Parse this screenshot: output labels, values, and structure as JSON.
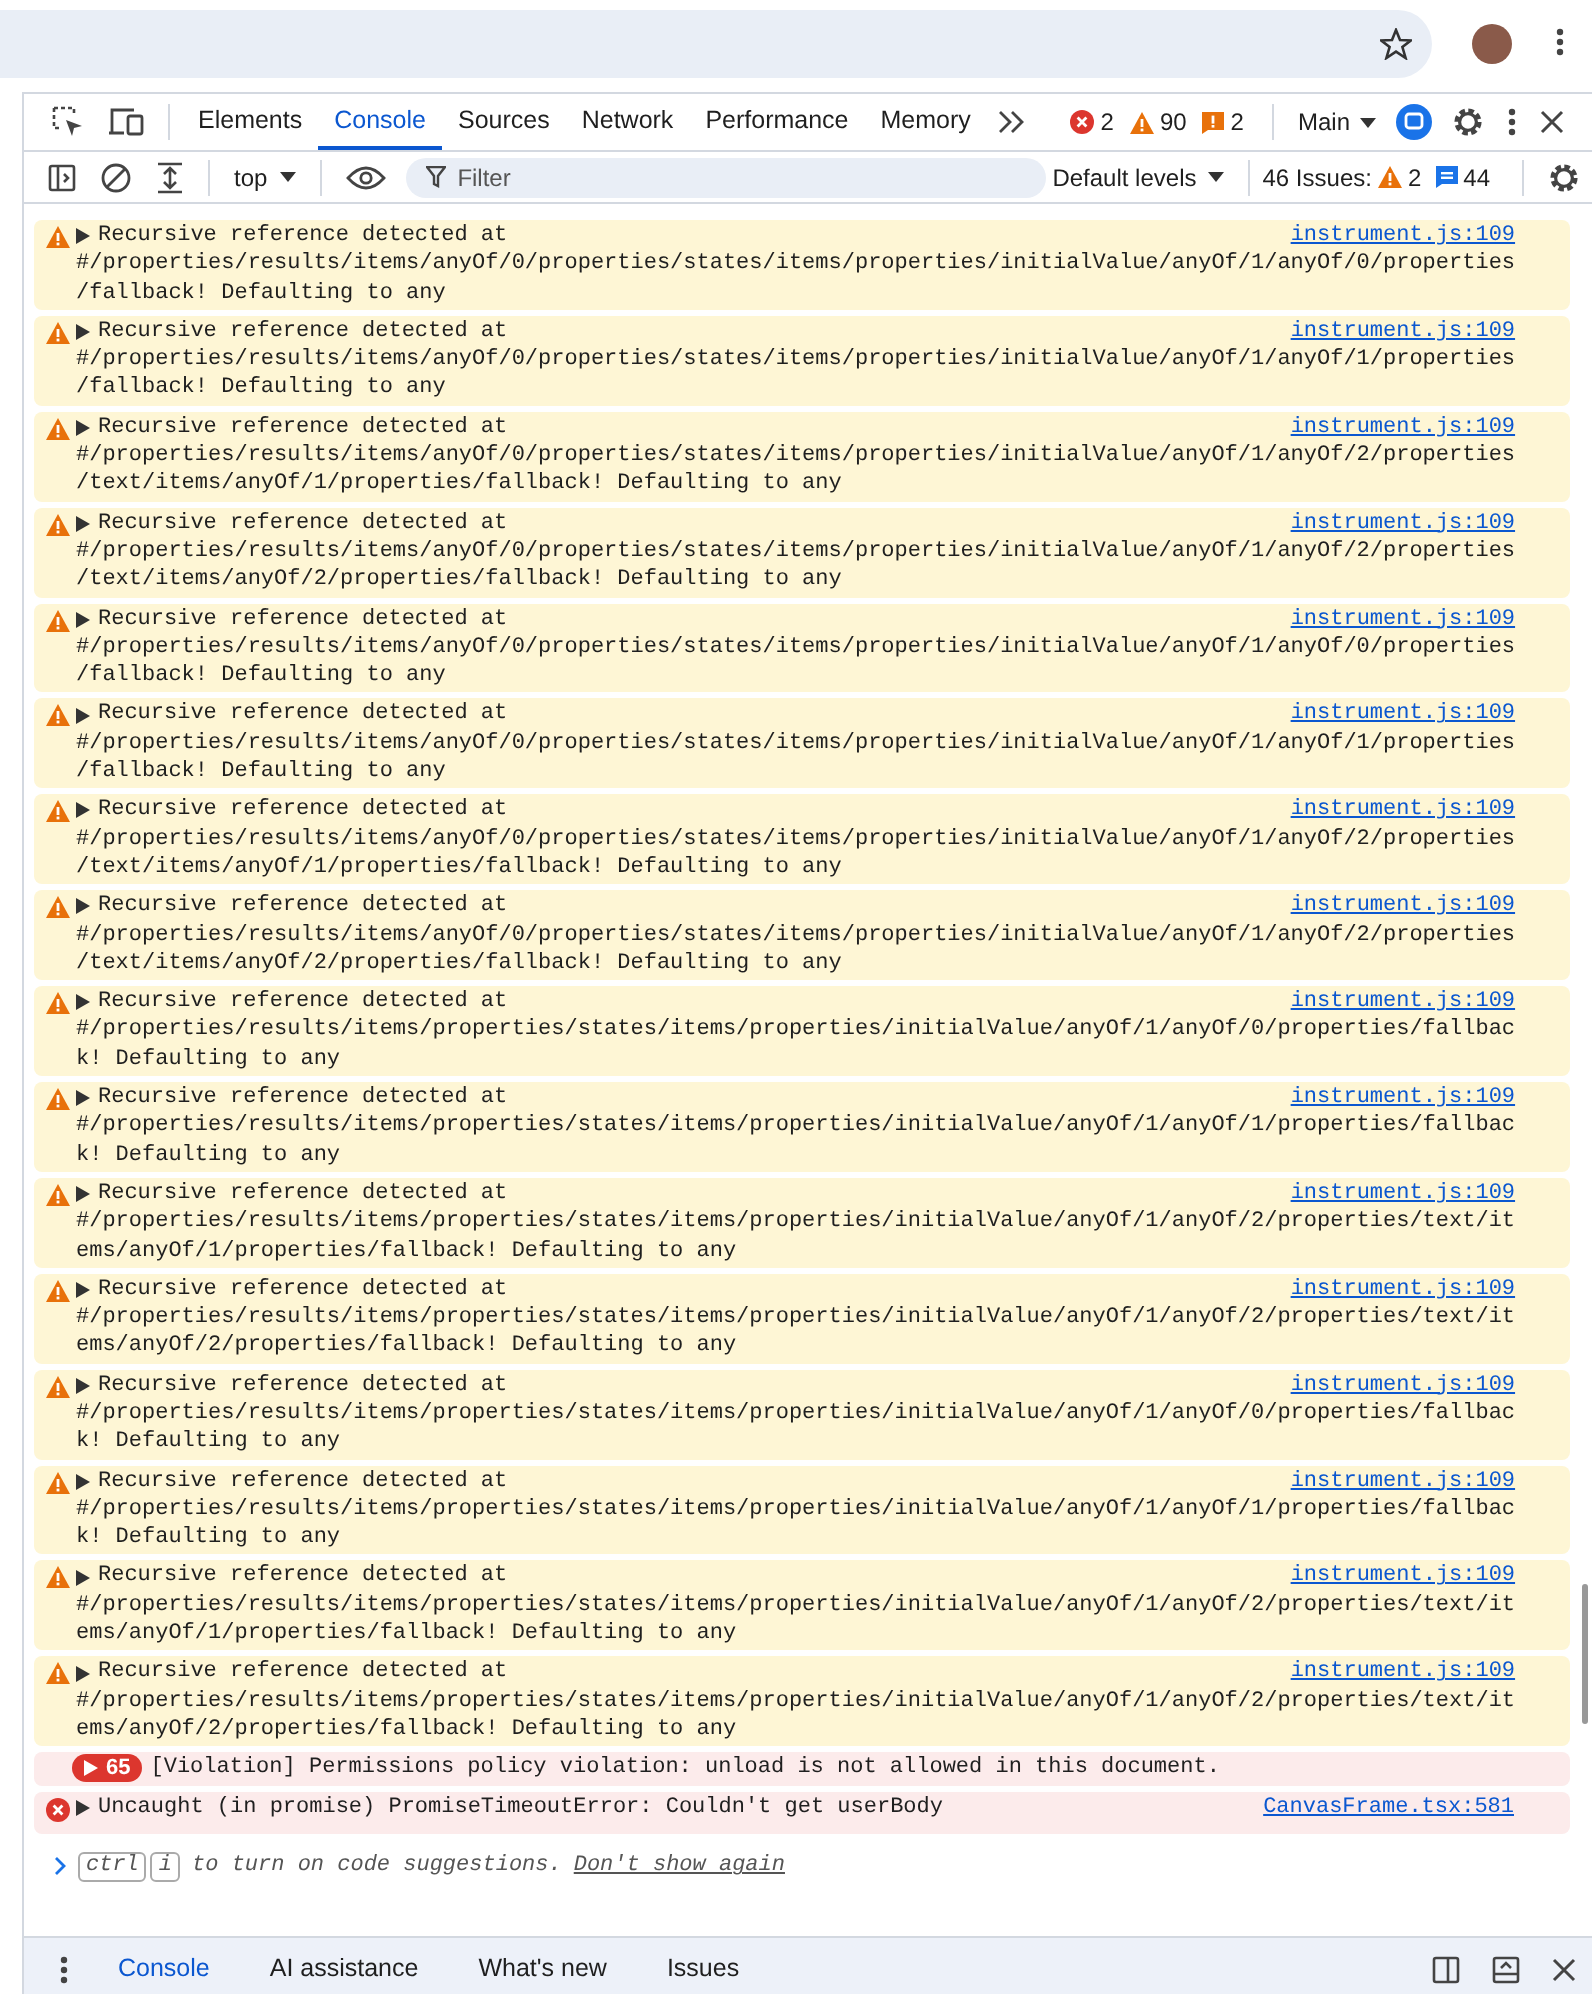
{
  "devtools": {
    "tabs": [
      {
        "label": "Elements",
        "selected": false
      },
      {
        "label": "Console",
        "selected": true
      },
      {
        "label": "Sources",
        "selected": false
      },
      {
        "label": "Network",
        "selected": false
      },
      {
        "label": "Performance",
        "selected": false
      },
      {
        "label": "Memory",
        "selected": false
      }
    ],
    "counts": [
      {
        "kind": "error",
        "count": "2"
      },
      {
        "kind": "warning",
        "count": "90"
      },
      {
        "kind": "issue",
        "count": "2"
      }
    ],
    "target": "Main"
  },
  "toolbar": {
    "context": "top",
    "filter_placeholder": "Filter",
    "levels": "Default levels",
    "issues_label": "46 Issues:",
    "issue_counts": [
      {
        "kind": "warning",
        "count": "2"
      },
      {
        "kind": "info",
        "count": "44"
      }
    ]
  },
  "messages": [
    {
      "kind": "warning",
      "lines": [
        "Recursive reference detected at",
        "#/properties/results/items/anyOf/0/properties/states/items/properties/initialValue/anyOf/1/anyOf/0/properties",
        "/fallback! Defaulting to any"
      ],
      "source": "instrument.js:109"
    },
    {
      "kind": "warning",
      "lines": [
        "Recursive reference detected at",
        "#/properties/results/items/anyOf/0/properties/states/items/properties/initialValue/anyOf/1/anyOf/1/properties",
        "/fallback! Defaulting to any"
      ],
      "source": "instrument.js:109"
    },
    {
      "kind": "warning",
      "lines": [
        "Recursive reference detected at",
        "#/properties/results/items/anyOf/0/properties/states/items/properties/initialValue/anyOf/1/anyOf/2/properties",
        "/text/items/anyOf/1/properties/fallback! Defaulting to any"
      ],
      "source": "instrument.js:109"
    },
    {
      "kind": "warning",
      "lines": [
        "Recursive reference detected at",
        "#/properties/results/items/anyOf/0/properties/states/items/properties/initialValue/anyOf/1/anyOf/2/properties",
        "/text/items/anyOf/2/properties/fallback! Defaulting to any"
      ],
      "source": "instrument.js:109"
    },
    {
      "kind": "warning",
      "lines": [
        "Recursive reference detected at",
        "#/properties/results/items/anyOf/0/properties/states/items/properties/initialValue/anyOf/1/anyOf/0/properties",
        "/fallback! Defaulting to any"
      ],
      "source": "instrument.js:109"
    },
    {
      "kind": "warning",
      "lines": [
        "Recursive reference detected at",
        "#/properties/results/items/anyOf/0/properties/states/items/properties/initialValue/anyOf/1/anyOf/1/properties",
        "/fallback! Defaulting to any"
      ],
      "source": "instrument.js:109"
    },
    {
      "kind": "warning",
      "lines": [
        "Recursive reference detected at",
        "#/properties/results/items/anyOf/0/properties/states/items/properties/initialValue/anyOf/1/anyOf/2/properties",
        "/text/items/anyOf/1/properties/fallback! Defaulting to any"
      ],
      "source": "instrument.js:109"
    },
    {
      "kind": "warning",
      "lines": [
        "Recursive reference detected at",
        "#/properties/results/items/anyOf/0/properties/states/items/properties/initialValue/anyOf/1/anyOf/2/properties",
        "/text/items/anyOf/2/properties/fallback! Defaulting to any"
      ],
      "source": "instrument.js:109"
    },
    {
      "kind": "warning",
      "lines": [
        "Recursive reference detected at",
        "#/properties/results/items/properties/states/items/properties/initialValue/anyOf/1/anyOf/0/properties/fallbac",
        "k! Defaulting to any"
      ],
      "source": "instrument.js:109"
    },
    {
      "kind": "warning",
      "lines": [
        "Recursive reference detected at",
        "#/properties/results/items/properties/states/items/properties/initialValue/anyOf/1/anyOf/1/properties/fallbac",
        "k! Defaulting to any"
      ],
      "source": "instrument.js:109"
    },
    {
      "kind": "warning",
      "lines": [
        "Recursive reference detected at",
        "#/properties/results/items/properties/states/items/properties/initialValue/anyOf/1/anyOf/2/properties/text/it",
        "ems/anyOf/1/properties/fallback! Defaulting to any"
      ],
      "source": "instrument.js:109"
    },
    {
      "kind": "warning",
      "lines": [
        "Recursive reference detected at",
        "#/properties/results/items/properties/states/items/properties/initialValue/anyOf/1/anyOf/2/properties/text/it",
        "ems/anyOf/2/properties/fallback! Defaulting to any"
      ],
      "source": "instrument.js:109"
    },
    {
      "kind": "warning",
      "lines": [
        "Recursive reference detected at",
        "#/properties/results/items/properties/states/items/properties/initialValue/anyOf/1/anyOf/0/properties/fallbac",
        "k! Defaulting to any"
      ],
      "source": "instrument.js:109"
    },
    {
      "kind": "warning",
      "lines": [
        "Recursive reference detected at",
        "#/properties/results/items/properties/states/items/properties/initialValue/anyOf/1/anyOf/1/properties/fallbac",
        "k! Defaulting to any"
      ],
      "source": "instrument.js:109"
    },
    {
      "kind": "warning",
      "lines": [
        "Recursive reference detected at",
        "#/properties/results/items/properties/states/items/properties/initialValue/anyOf/1/anyOf/2/properties/text/it",
        "ems/anyOf/1/properties/fallback! Defaulting to any"
      ],
      "source": "instrument.js:109"
    },
    {
      "kind": "warning",
      "lines": [
        "Recursive reference detected at",
        "#/properties/results/items/properties/states/items/properties/initialValue/anyOf/1/anyOf/2/properties/text/it",
        "ems/anyOf/2/properties/fallback! Defaulting to any"
      ],
      "source": "instrument.js:109"
    },
    {
      "kind": "violation",
      "count": "65",
      "lines": [
        "[Violation] Permissions policy violation: unload is not allowed in this document."
      ]
    },
    {
      "kind": "error",
      "lines": [
        "Uncaught (in promise) PromiseTimeoutError: Couldn't get userBody"
      ],
      "source": "CanvasFrame.tsx:581"
    }
  ],
  "prompt": {
    "shortcut_keys": [
      "ctrl",
      "i"
    ],
    "hint": "to turn on code suggestions.",
    "link": "Don't show again"
  },
  "drawer_tabs": [
    {
      "label": "Console",
      "selected": true
    },
    {
      "label": "AI assistance",
      "selected": false
    },
    {
      "label": "What's new",
      "selected": false
    },
    {
      "label": "Issues",
      "selected": false
    }
  ]
}
